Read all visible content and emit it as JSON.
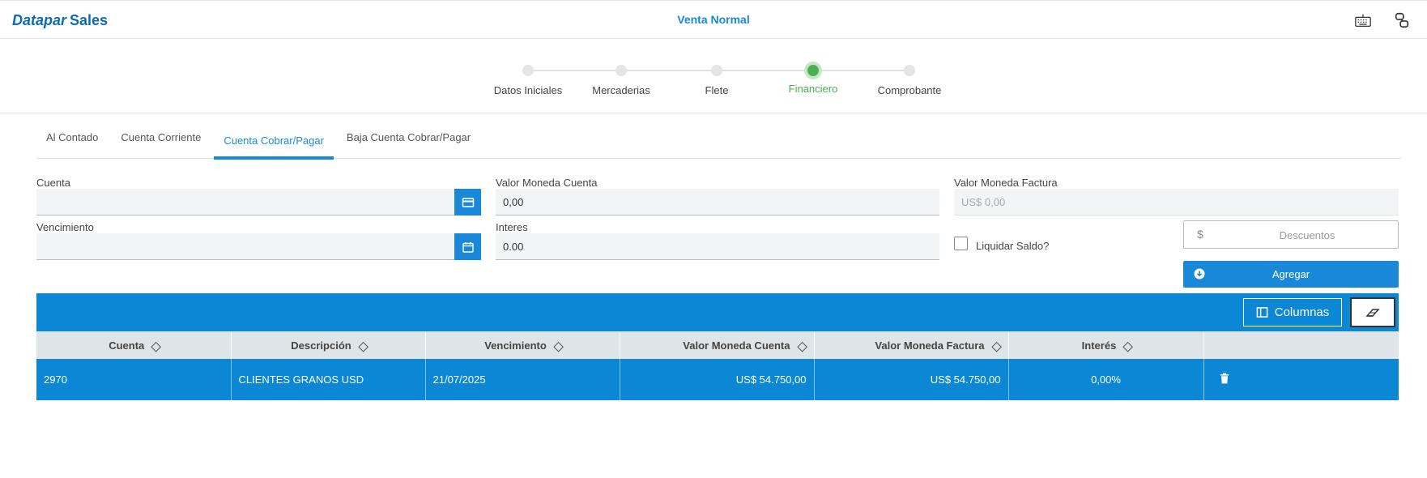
{
  "header": {
    "brand": "Datapar",
    "product": "Sales",
    "title": "Venta Normal",
    "icons": [
      "keyboard-icon",
      "link-icon"
    ]
  },
  "stepper": {
    "steps": [
      {
        "label": "Datos Iniciales",
        "active": false
      },
      {
        "label": "Mercaderias",
        "active": false
      },
      {
        "label": "Flete",
        "active": false
      },
      {
        "label": "Financiero",
        "active": true
      },
      {
        "label": "Comprobante",
        "active": false
      }
    ],
    "active_color": "#4caf50"
  },
  "tabs": [
    {
      "label": "Al Contado",
      "active": false
    },
    {
      "label": "Cuenta Corriente",
      "active": false
    },
    {
      "label": "Cuenta Cobrar/Pagar",
      "active": true
    },
    {
      "label": "Baja Cuenta Cobrar/Pagar",
      "active": false
    }
  ],
  "form": {
    "cuenta": {
      "label": "Cuenta",
      "value": ""
    },
    "valor_moneda_cuenta": {
      "label": "Valor Moneda Cuenta",
      "value": "0,00"
    },
    "valor_moneda_factura": {
      "label": "Valor Moneda Factura",
      "value": "US$ 0,00"
    },
    "vencimiento": {
      "label": "Vencimiento",
      "value": ""
    },
    "interes": {
      "label": "Interes",
      "value": "0.00"
    },
    "liquidar_saldo": {
      "label": "Liquidar Saldo?",
      "checked": false
    },
    "descuentos": {
      "currency": "$",
      "placeholder": "Descuentos"
    },
    "agregar_label": "Agregar"
  },
  "grid": {
    "columns_button": "Columnas",
    "headers": [
      "Cuenta",
      "Descripción",
      "Vencimiento",
      "Valor Moneda Cuenta",
      "Valor Moneda Factura",
      "Interés",
      ""
    ],
    "rows": [
      {
        "cuenta": "2970",
        "descripcion": "CLIENTES GRANOS USD",
        "vencimiento": "21/07/2025",
        "valor_moneda_cuenta": "US$ 54.750,00",
        "valor_moneda_factura": "US$ 54.750,00",
        "interes": "0,00%"
      }
    ]
  },
  "colors": {
    "primary": "#1a88d8",
    "grid_bg": "#0b87d6"
  }
}
